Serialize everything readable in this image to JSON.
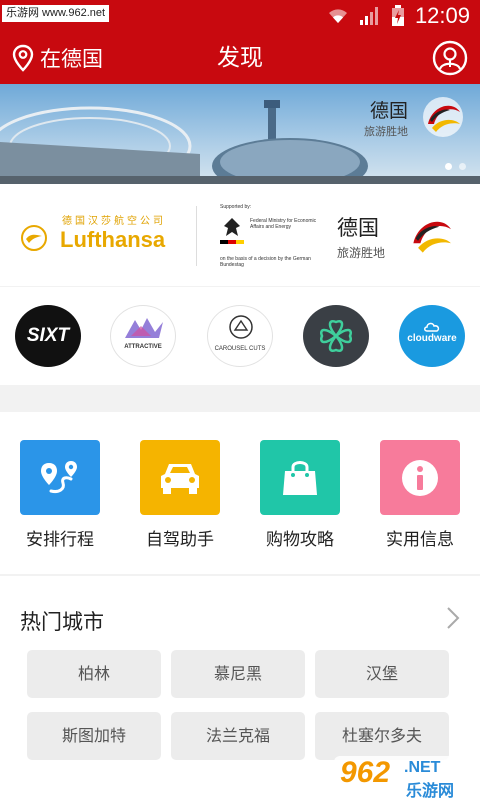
{
  "watermark_top": "乐游网 www.962.net",
  "status": {
    "time": "12:09"
  },
  "nav": {
    "location": "在德国",
    "title": "发现"
  },
  "banner": {
    "brand_main": "德国",
    "brand_sub": "旅游胜地"
  },
  "sponsor": {
    "lufthansa_cn": "德国汉莎航空公司",
    "lufthansa_name": "Lufthansa",
    "ministry_supported": "Supported by:",
    "ministry_name": "Federal Ministry for Economic Affairs and Energy",
    "ministry_basis": "on the basis of a decision by the German Bundestag",
    "brand_main": "德国",
    "brand_sub": "旅游胜地"
  },
  "partners": [
    {
      "name": "SIXT"
    },
    {
      "name": "ATTRACTIVE"
    },
    {
      "name": "CAROUSEL CUTS"
    },
    {
      "name": "clover-logo"
    },
    {
      "name": "cloudware"
    }
  ],
  "features": [
    {
      "label": "安排行程",
      "color": "#2b95e8",
      "icon": "route-icon"
    },
    {
      "label": "自驾助手",
      "color": "#f5b400",
      "icon": "car-icon"
    },
    {
      "label": "购物攻略",
      "color": "#20c6a8",
      "icon": "shopping-bag-icon"
    },
    {
      "label": "实用信息",
      "color": "#f77b9b",
      "icon": "info-icon"
    }
  ],
  "cities": {
    "title": "热门城市",
    "items": [
      "柏林",
      "慕尼黑",
      "汉堡",
      "斯图加特",
      "法兰克福",
      "杜塞尔多夫"
    ]
  },
  "watermark_bottom": {
    "number": "962",
    "suffix": ".NET",
    "name": "乐游网"
  },
  "colors": {
    "primary": "#c8090f"
  }
}
